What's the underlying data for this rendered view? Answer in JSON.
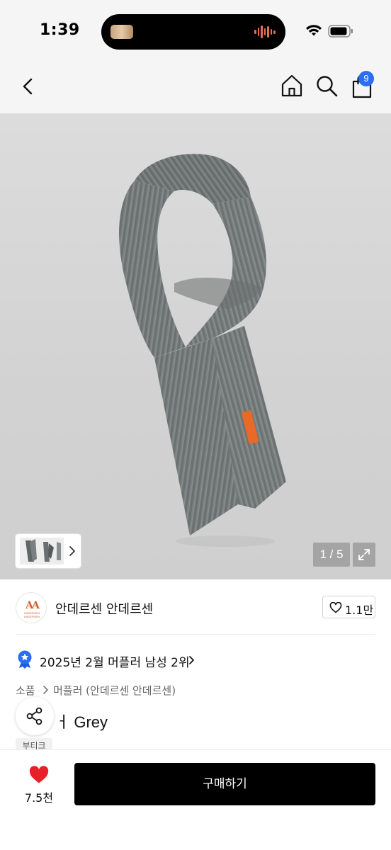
{
  "status_bar": {
    "time": "1:39"
  },
  "nav": {
    "back_icon": "chevron-left-icon",
    "home_icon": "home-icon",
    "search_icon": "search-icon",
    "cart_icon": "shopping-bag-icon",
    "cart_count": "9",
    "badge_color": "#2a6ef5"
  },
  "gallery": {
    "page_indicator": "1 / 5",
    "current_page": 1,
    "total_pages": 5
  },
  "brand": {
    "logo_mark": "AA",
    "logo_text": "ANDERSEN ANDERSEN",
    "name": "안데르센 안데르센",
    "like_count": "1.1만"
  },
  "ranking": {
    "text": "2025년 2월 머플러 남성 2위"
  },
  "breadcrumb": {
    "category": "소품",
    "subcategory": "머플러 (안데르센 안데르센)"
  },
  "product": {
    "title_visible": "ㅓ Grey",
    "tag": "부티크"
  },
  "bottom_bar": {
    "wish_count": "7.5천",
    "buy_label": "구매하기",
    "heart_color": "#e8202a"
  }
}
